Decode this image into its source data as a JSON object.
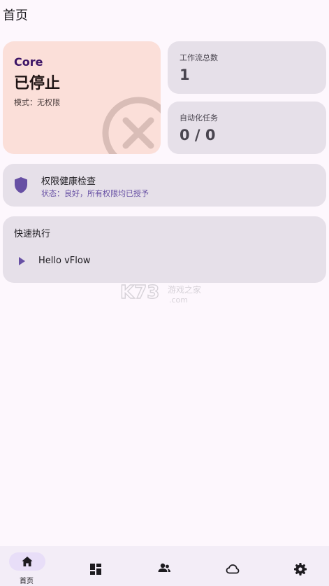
{
  "page": {
    "title": "首页"
  },
  "core": {
    "label": "Core",
    "status": "已停止",
    "mode": "模式：无权限",
    "status_icon": "close-circle-icon",
    "colors": {
      "card_bg": "#fbdfd9",
      "label": "#3c1466",
      "icon": "#d9bdb7"
    }
  },
  "stats": {
    "workflows": {
      "label": "工作流总数",
      "value": "1"
    },
    "tasks": {
      "label": "自动化任务",
      "value": "0 / 0"
    }
  },
  "health": {
    "title": "权限健康检查",
    "status": "状态：良好，所有权限均已授予",
    "icon": "shield-icon",
    "accent": "#6750a4"
  },
  "quick": {
    "title": "快速执行",
    "items": [
      {
        "label": "Hello vFlow",
        "icon": "play-icon"
      }
    ]
  },
  "watermark": {
    "text": "K73 游戏之家 .com"
  },
  "nav": {
    "items": [
      {
        "label": "首页",
        "icon": "home-icon",
        "active": true
      },
      {
        "label": "",
        "icon": "dashboard-icon",
        "active": false
      },
      {
        "label": "",
        "icon": "people-icon",
        "active": false
      },
      {
        "label": "",
        "icon": "cloud-icon",
        "active": false
      },
      {
        "label": "",
        "icon": "settings-icon",
        "active": false
      }
    ],
    "active_pill_color": "#e8def8"
  }
}
